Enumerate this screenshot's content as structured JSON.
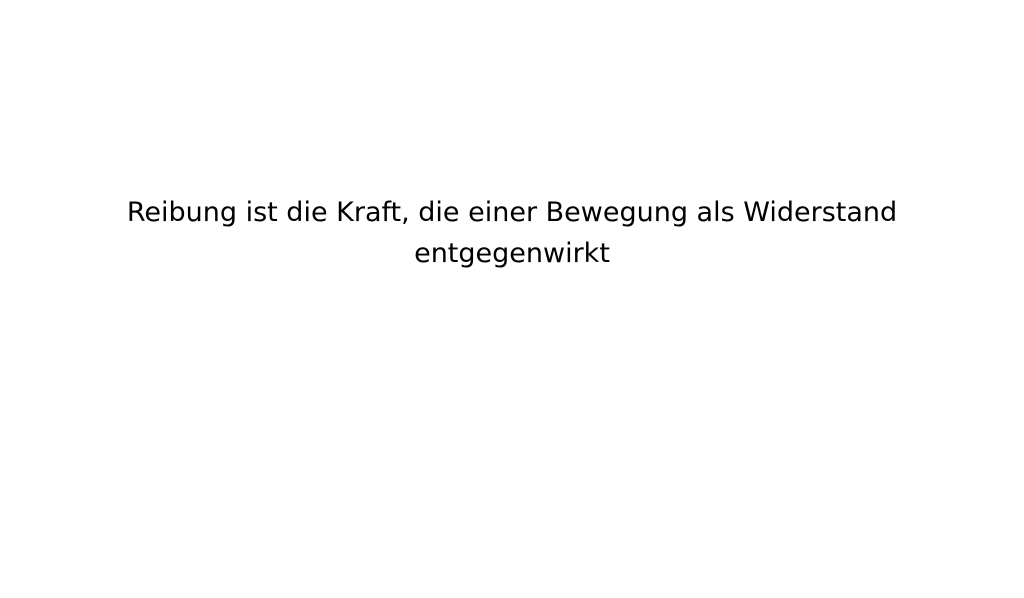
{
  "slide": {
    "text": "Reibung ist die Kraft, die einer Bewegung als Widerstand entgegenwirkt",
    "text_color": "#000000",
    "background_color": "#ffffff"
  }
}
